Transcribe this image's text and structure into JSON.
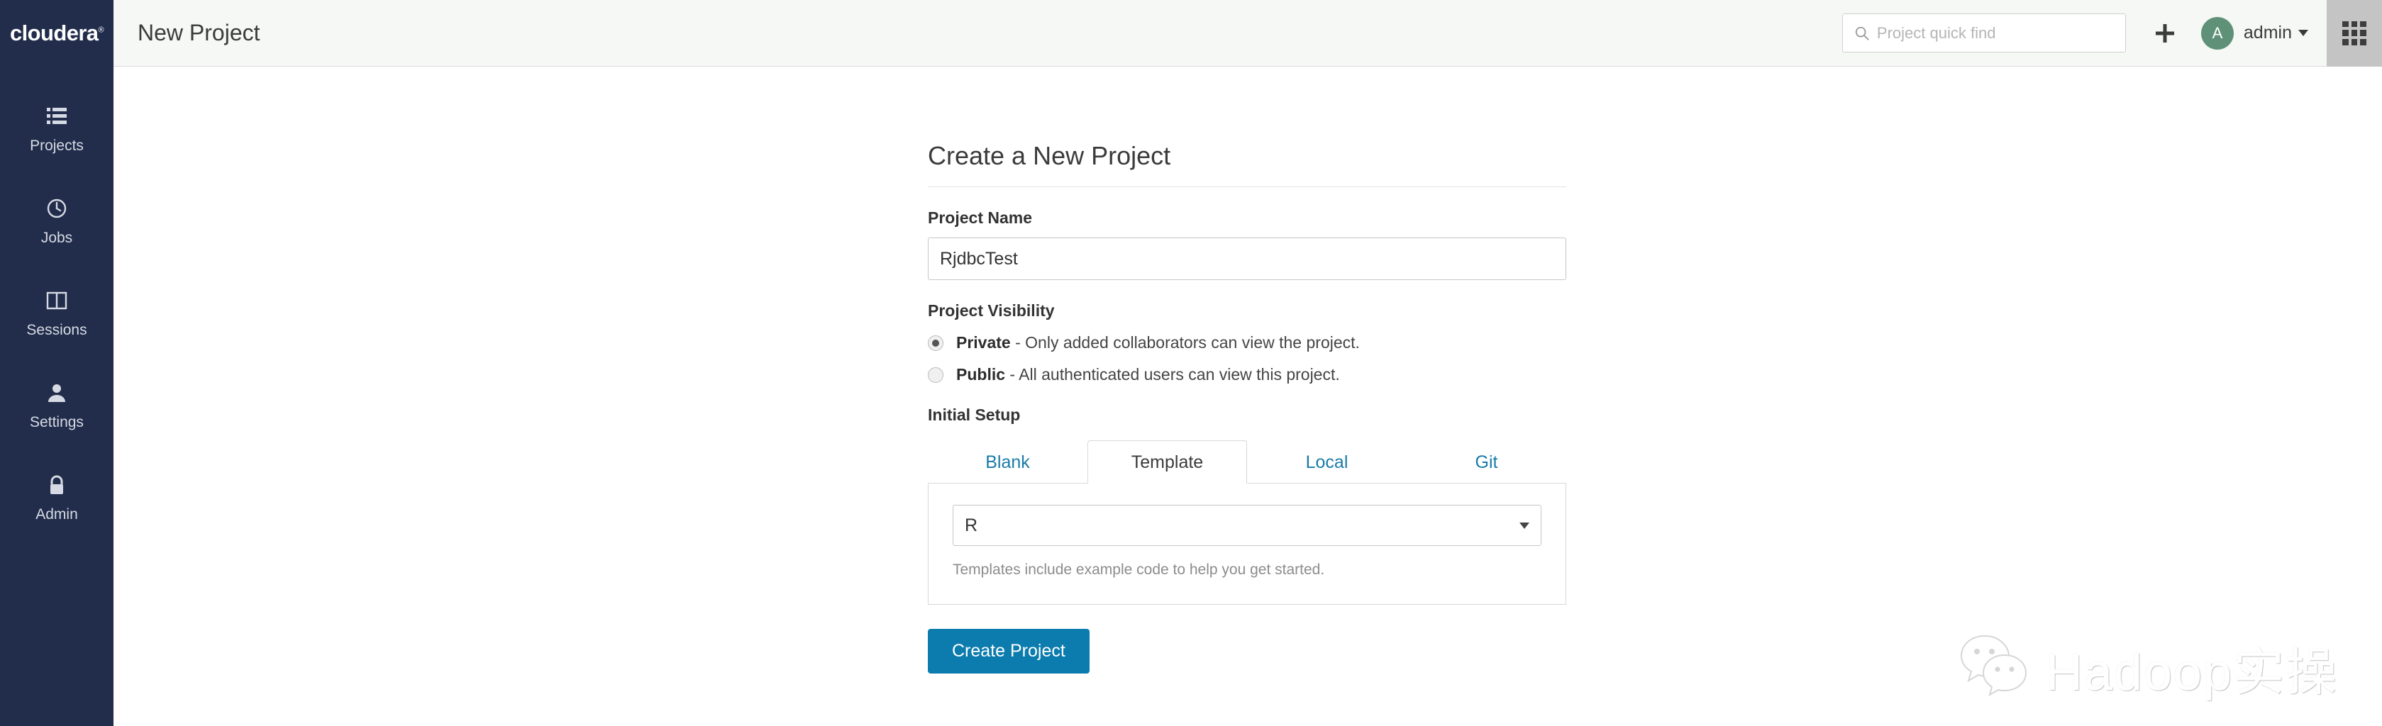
{
  "brand": {
    "logo_text": "cloudera",
    "logo_mark": "®"
  },
  "header": {
    "title": "New Project",
    "search": {
      "placeholder": "Project quick find",
      "value": "",
      "icon": "search-icon"
    },
    "add_icon": "plus-icon",
    "user": {
      "initial": "A",
      "name": "admin",
      "caret_icon": "chevron-down-icon"
    },
    "apps_icon": "apps-grid-icon",
    "background": "#f5f8f4"
  },
  "sidebar": {
    "background": "#222d4b",
    "items": [
      {
        "label": "Projects",
        "icon": "list-icon"
      },
      {
        "label": "Jobs",
        "icon": "clock-icon"
      },
      {
        "label": "Sessions",
        "icon": "columns-icon"
      },
      {
        "label": "Settings",
        "icon": "user-icon"
      },
      {
        "label": "Admin",
        "icon": "lock-icon"
      }
    ]
  },
  "form": {
    "heading": "Create a New Project",
    "project_name": {
      "label": "Project Name",
      "value": "RjdbcTest",
      "placeholder": ""
    },
    "visibility": {
      "label": "Project Visibility",
      "options": [
        {
          "name": "Private",
          "description": "- Only added collaborators can view the project.",
          "selected": true
        },
        {
          "name": "Public",
          "description": "- All authenticated users can view this project.",
          "selected": false
        }
      ]
    },
    "initial_setup": {
      "label": "Initial Setup",
      "tabs": [
        {
          "label": "Blank",
          "active": false
        },
        {
          "label": "Template",
          "active": true
        },
        {
          "label": "Local",
          "active": false
        },
        {
          "label": "Git",
          "active": false
        }
      ],
      "template_select": {
        "value": "R",
        "caret_icon": "chevron-down-icon"
      },
      "helper_text": "Templates include example code to help you get started."
    },
    "submit_label": "Create Project",
    "submit_color": "#0b7cad"
  },
  "watermark": {
    "text": "Hadoop实操",
    "icon": "wechat-bubbles-icon"
  }
}
